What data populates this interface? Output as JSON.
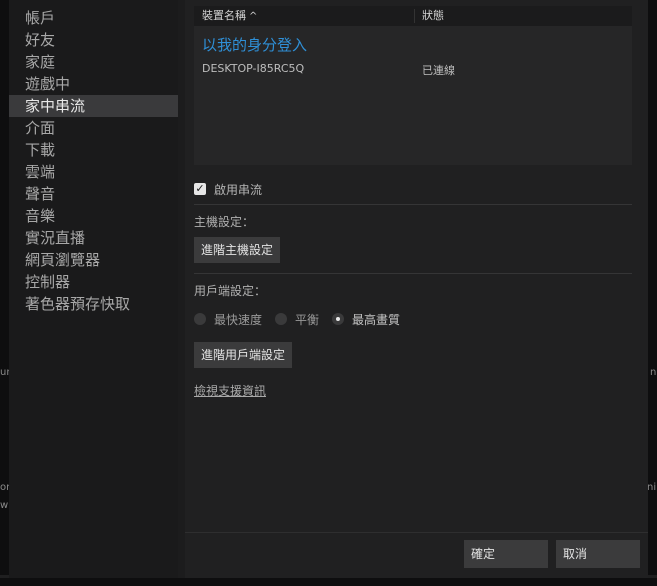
{
  "background": {
    "left_fragments": [
      "ur",
      "on",
      "w"
    ],
    "right_fragments": [
      "n",
      "nil"
    ]
  },
  "sidebar": {
    "items": [
      {
        "label": "帳戶"
      },
      {
        "label": "好友"
      },
      {
        "label": "家庭"
      },
      {
        "label": "遊戲中"
      },
      {
        "label": "家中串流",
        "active": true
      },
      {
        "label": "介面"
      },
      {
        "label": "下載"
      },
      {
        "label": "雲端"
      },
      {
        "label": "聲音"
      },
      {
        "label": "音樂"
      },
      {
        "label": "實況直播"
      },
      {
        "label": "網頁瀏覽器"
      },
      {
        "label": "控制器"
      },
      {
        "label": "著色器預存快取"
      }
    ]
  },
  "devices": {
    "header_name": "裝置名稱",
    "header_sort_icon": "^",
    "header_status": "狀態",
    "login_link": "以我的身分登入",
    "rows": [
      {
        "name": "DESKTOP-I85RC5Q",
        "status": "已連線"
      }
    ]
  },
  "streaming": {
    "enable_label": "啟用串流",
    "enable_checked": true,
    "host_settings_label": "主機設定：",
    "advanced_host_button": "進階主機設定",
    "client_settings_label": "用戶端設定：",
    "client_options": [
      {
        "label": "最快速度",
        "selected": false
      },
      {
        "label": "平衡",
        "selected": false
      },
      {
        "label": "最高畫質",
        "selected": true
      }
    ],
    "advanced_client_button": "進階用戶端設定",
    "support_link": "檢視支援資訊"
  },
  "footer": {
    "ok_label": "確定",
    "cancel_label": "取消"
  }
}
